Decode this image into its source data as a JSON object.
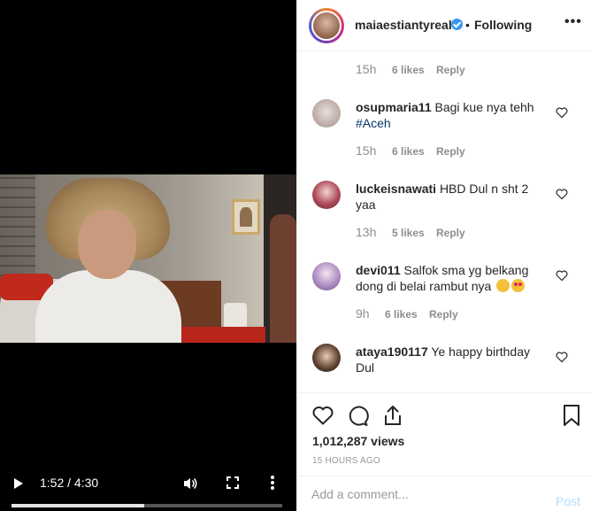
{
  "video": {
    "time_display": "1:52 / 4:30",
    "progress_fraction": 0.49,
    "buffered_fraction": 0.47,
    "icons": {
      "play": "play-icon",
      "volume": "volume-icon",
      "fullscreen": "fullscreen-icon",
      "more": "more-vertical-icon"
    }
  },
  "header": {
    "username": "maiaestiantyreal",
    "separator": "•",
    "follow_status": "Following",
    "options": "•••"
  },
  "comments": [
    {
      "username": "",
      "text": "",
      "hashtag": "",
      "time": "15h",
      "likes": "6 likes",
      "reply": "Reply"
    },
    {
      "username": "osupmaria11",
      "text": "Bagi kue nya tehh",
      "hashtag": "#Aceh",
      "time": "15h",
      "likes": "6 likes",
      "reply": "Reply"
    },
    {
      "username": "luckeisnawati",
      "text": "HBD Dul n sht 2 yaa",
      "hashtag": "",
      "time": "13h",
      "likes": "5 likes",
      "reply": "Reply"
    },
    {
      "username": "devi011",
      "text": "Salfok sma yg belkang dong di belai rambut nya",
      "hashtag": "",
      "time": "9h",
      "likes": "6 likes",
      "reply": "Reply"
    },
    {
      "username": "ataya190117",
      "text": "Ye happy birthday Dul",
      "hashtag": "",
      "time": "",
      "likes": "",
      "reply": ""
    }
  ],
  "actions": {
    "views": "1,012,287 views",
    "posted": "15 HOURS AGO"
  },
  "add_comment": {
    "placeholder": "Add a comment...",
    "post_label": "Post"
  },
  "colors": {
    "link": "#003569",
    "verified": "#3897f0",
    "post_disabled": "#b2dffc"
  }
}
